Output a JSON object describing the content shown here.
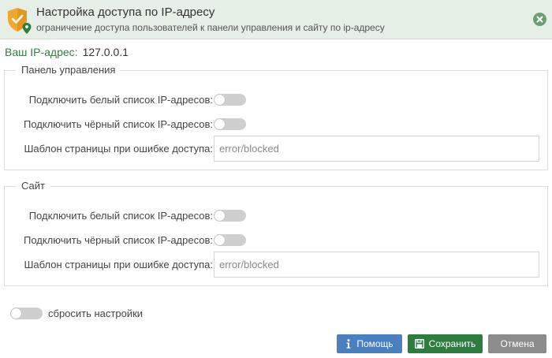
{
  "header": {
    "title": "Настройка доступа по IP-адресу",
    "subtitle": "ограничение доступа пользователей к панели управления и сайту по ip-адресу",
    "icon": "shield-location-icon",
    "close_icon": "close-icon"
  },
  "ip": {
    "label": "Ваш IP-адрес:",
    "value": "127.0.0.1"
  },
  "panel": {
    "legend": "Панель управления",
    "whitelist_label": "Подключить белый список IP-адресов:",
    "whitelist_enabled": false,
    "blacklist_label": "Подключить чёрный список IP-адресов:",
    "blacklist_enabled": false,
    "template_label": "Шаблон страницы при ошибке доступа:",
    "template_placeholder": "error/blocked",
    "template_value": ""
  },
  "site": {
    "legend": "Сайт",
    "whitelist_label": "Подключить белый список IP-адресов:",
    "whitelist_enabled": false,
    "blacklist_label": "Подключить чёрный список IP-адресов:",
    "blacklist_enabled": false,
    "template_label": "Шаблон страницы при ошибке доступа:",
    "template_placeholder": "error/blocked",
    "template_value": ""
  },
  "reset": {
    "label": "сбросить настройки",
    "enabled": false
  },
  "buttons": {
    "help": "Помощь",
    "save": "Сохранить",
    "cancel": "Отмена"
  },
  "colors": {
    "header_bg": "#e6efe6",
    "accent_green": "#2d7d3f",
    "help_blue": "#4a7fc1",
    "cancel_gray": "#8c8c8c",
    "shield_orange": "#f0a830"
  }
}
